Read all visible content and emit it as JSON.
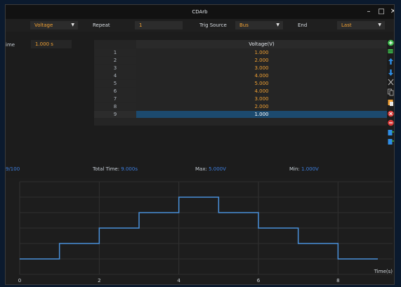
{
  "window": {
    "title": "CDArb"
  },
  "toolbar": {
    "mode_value": "Voltage",
    "repeat_label": "Repeat",
    "repeat_value": "1",
    "trig_source_label": "Trig Source",
    "trig_source_value": "Bus",
    "end_label": "End",
    "end_value": "Last"
  },
  "left": {
    "time_label": "ime",
    "time_value": "1.000 s"
  },
  "table": {
    "header": "Voltage(V)",
    "rows": [
      {
        "idx": "1",
        "value": "1.000"
      },
      {
        "idx": "2",
        "value": "2.000"
      },
      {
        "idx": "3",
        "value": "3.000"
      },
      {
        "idx": "4",
        "value": "4.000"
      },
      {
        "idx": "5",
        "value": "5.000"
      },
      {
        "idx": "6",
        "value": "4.000"
      },
      {
        "idx": "7",
        "value": "3.000"
      },
      {
        "idx": "8",
        "value": "2.000"
      },
      {
        "idx": "9",
        "value": "1.000"
      }
    ],
    "selected_row": 9
  },
  "status": {
    "count": "9/100",
    "total_time_label": "Total Time:",
    "total_time_value": "9.000s",
    "max_label": "Max:",
    "max_value": "5.000V",
    "min_label": "Min:",
    "min_value": "1.000V"
  },
  "sidebar_icons": [
    {
      "name": "add-row-icon",
      "color": "#3cba4b"
    },
    {
      "name": "insert-rows-icon",
      "color": "#3cba4b"
    },
    {
      "name": "move-up-icon",
      "color": "#2f8ee6"
    },
    {
      "name": "move-down-icon",
      "color": "#2f8ee6"
    },
    {
      "name": "cut-icon",
      "color": "#b8b8b8"
    },
    {
      "name": "copy-icon",
      "color": "#b8b8b8"
    },
    {
      "name": "paste-icon",
      "color": "#f0a033"
    },
    {
      "name": "delete-icon",
      "color": "#d93a3a"
    },
    {
      "name": "remove-icon",
      "color": "#d93a3a"
    },
    {
      "name": "import-icon",
      "color": "#2f8ee6"
    },
    {
      "name": "export-icon",
      "color": "#2f8ee6"
    }
  ],
  "chart_data": {
    "type": "line",
    "step": "post",
    "xlabel": "Time(s)",
    "x_ticks": [
      "0",
      "2",
      "4",
      "6",
      "8"
    ],
    "xlim": [
      0,
      9
    ],
    "ylim": [
      0,
      6
    ],
    "grid": true,
    "x": [
      0,
      1,
      2,
      3,
      4,
      5,
      6,
      7,
      8,
      9
    ],
    "y": [
      1,
      2,
      3,
      4,
      5,
      4,
      3,
      2,
      1,
      1
    ],
    "line_color": "#4a90d9"
  }
}
